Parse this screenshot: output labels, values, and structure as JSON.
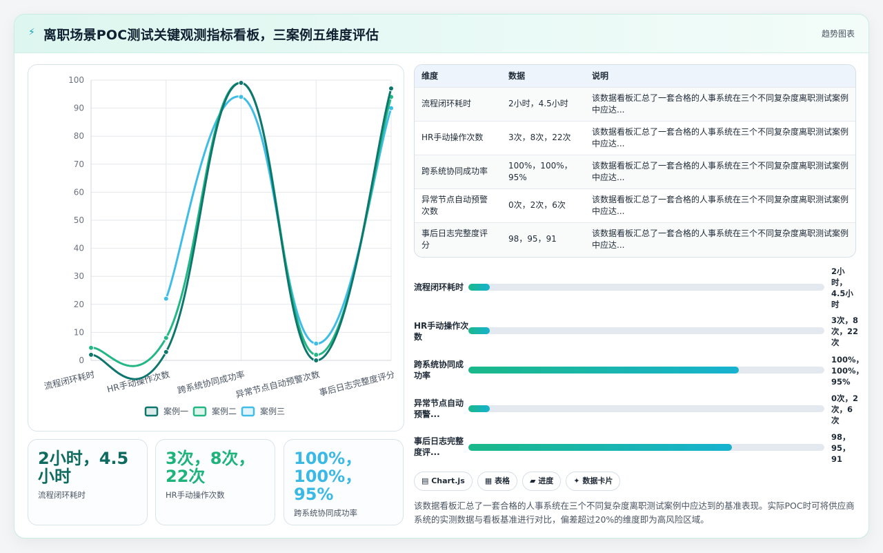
{
  "header": {
    "icon": "bolt-icon",
    "title": "离职场景POC测试关键观测指标看板，三案例五维度评估",
    "trend_label": "趋势图表"
  },
  "chart_data": {
    "type": "line",
    "categories": [
      "流程闭环耗时",
      "HR手动操作次数",
      "跨系统协同成功率",
      "异常节点自动预警次数",
      "事后日志完整度评分"
    ],
    "series": [
      {
        "name": "案例一",
        "values": [
          2,
          3,
          99,
          0,
          97
        ],
        "color": "#0f766e"
      },
      {
        "name": "案例二",
        "values": [
          4.5,
          8,
          99,
          2,
          94
        ],
        "color": "#22b784"
      },
      {
        "name": "案例三",
        "values": [
          null,
          22,
          94,
          6,
          90
        ],
        "color": "#3fbde6"
      }
    ],
    "ylim": [
      0,
      100
    ],
    "yticks": [
      0,
      10,
      20,
      30,
      40,
      50,
      60,
      70,
      80,
      90,
      100
    ],
    "grid": true,
    "legend": "bottom"
  },
  "stats": [
    {
      "value": "2小时，4.5小时",
      "label": "流程闭环耗时",
      "color": "#0f6b5f"
    },
    {
      "value": "3次，8次，22次",
      "label": "HR手动操作次数",
      "color": "#1fb37c"
    },
    {
      "value": "100%，100%，95%",
      "label": "跨系统协同成功率",
      "color": "#3ab8e6"
    }
  ],
  "table": {
    "headers": [
      "维度",
      "数据",
      "说明"
    ],
    "rows": [
      {
        "dim": "流程闭环耗时",
        "data": "2小时，4.5小时",
        "desc": "该数据看板汇总了一套合格的人事系统在三个不同复杂度离职测试案例中应达..."
      },
      {
        "dim": "HR手动操作次数",
        "data": "3次，8次，22次",
        "desc": "该数据看板汇总了一套合格的人事系统在三个不同复杂度离职测试案例中应达..."
      },
      {
        "dim": "跨系统协同成功率",
        "data": "100%，100%，95%",
        "desc": "该数据看板汇总了一套合格的人事系统在三个不同复杂度离职测试案例中应达..."
      },
      {
        "dim": "异常节点自动预警次数",
        "data": "0次，2次，6次",
        "desc": "该数据看板汇总了一套合格的人事系统在三个不同复杂度离职测试案例中应达..."
      },
      {
        "dim": "事后日志完整度评分",
        "data": "98，95，91",
        "desc": "该数据看板汇总了一套合格的人事系统在三个不同复杂度离职测试案例中应达..."
      }
    ]
  },
  "progress": [
    {
      "label": "流程闭环耗时",
      "value": "2小时，4.5小时",
      "fraction": 0.06
    },
    {
      "label": "HR手动操作次数",
      "value": "3次，8次，22次",
      "fraction": 0.06
    },
    {
      "label": "跨系统协同成功率",
      "value": "100%，100%，95%",
      "fraction": 0.76
    },
    {
      "label": "异常节点自动预警...",
      "value": "0次，2次，6次",
      "fraction": 0.06
    },
    {
      "label": "事后日志完整度评...",
      "value": "98，95，91",
      "fraction": 0.74
    }
  ],
  "chips": [
    {
      "icon": "chart-icon",
      "label": "Chart.js"
    },
    {
      "icon": "table-icon",
      "label": "表格"
    },
    {
      "icon": "progress-icon",
      "label": "进度"
    },
    {
      "icon": "sparkle-icon",
      "label": "数据卡片"
    }
  ],
  "summary": "该数据看板汇总了一套合格的人事系统在三个不同复杂度离职测试案例中应达到的基准表现。实际POC时可将供应商系统的实测数据与看板基准进行对比，偏差超过20%的维度即为高风险区域。"
}
